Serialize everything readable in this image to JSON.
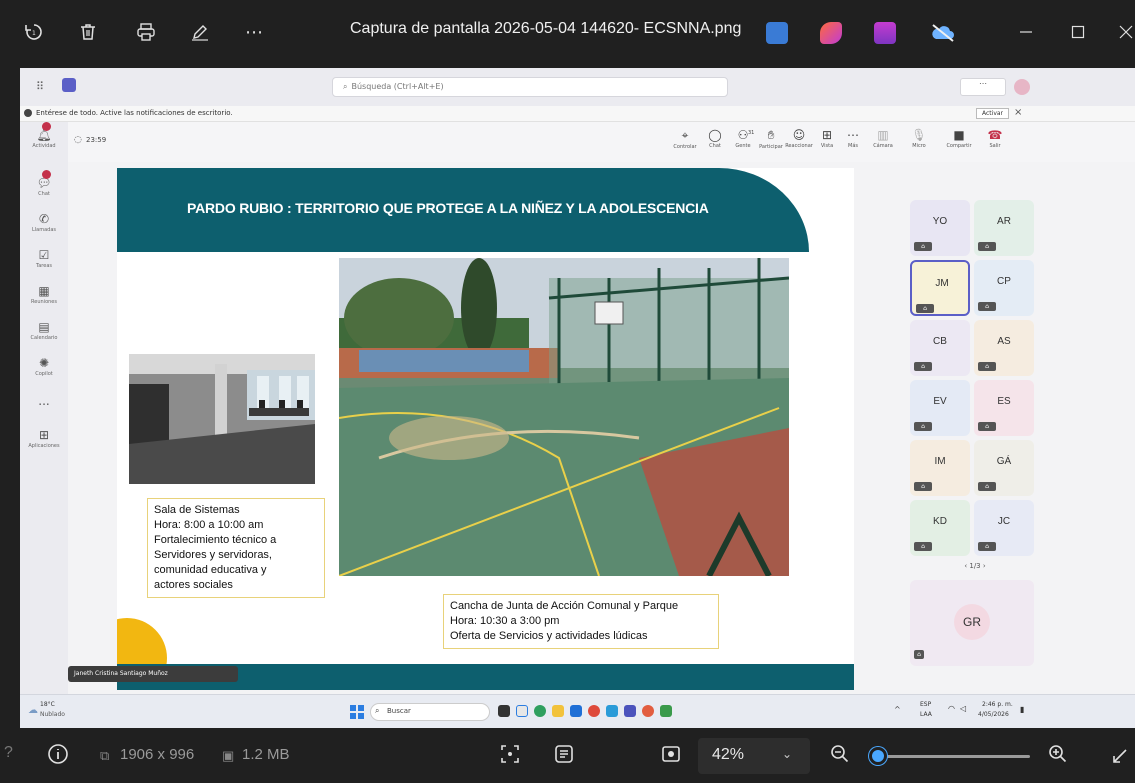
{
  "viewer": {
    "title": "Captura de pantalla 2026-05-04 144620- ECSNNA.png",
    "more_icon": "⋯",
    "dimensions": "1906 x 996",
    "file_size": "1.2 MB",
    "zoom_level": "42%",
    "zoom_fraction": 0.42
  },
  "teams": {
    "search_placeholder": "Búsqueda (Ctrl+Alt+E)",
    "notification": "Entérese de todo. Active las notificaciones de escritorio.",
    "notification_action": "Activar",
    "timer": "23:59",
    "rail": [
      {
        "label": "Actividad",
        "icon": "bell-icon"
      },
      {
        "label": "Chat",
        "icon": "chat-icon"
      },
      {
        "label": "Llamadas",
        "icon": "phone-icon"
      },
      {
        "label": "Tareas",
        "icon": "tasks-icon"
      },
      {
        "label": "Reuniones",
        "icon": "meetings-icon"
      },
      {
        "label": "Calendario",
        "icon": "calendar-icon"
      },
      {
        "label": "Copilot",
        "icon": "copilot-icon"
      },
      {
        "label": "...",
        "icon": "more-icon"
      },
      {
        "label": "Aplicaciones",
        "icon": "apps-icon"
      }
    ],
    "controls": [
      {
        "label": "Controlar"
      },
      {
        "label": "Chat"
      },
      {
        "label": "Gente"
      },
      {
        "label": "Participar"
      },
      {
        "label": "Reaccionar"
      },
      {
        "label": "Vista"
      },
      {
        "label": "Más"
      },
      {
        "label": "Cámara"
      },
      {
        "label": "Micro"
      },
      {
        "label": "Compartir"
      },
      {
        "label": "Salir"
      }
    ],
    "people_count": "31",
    "participants": [
      "YO",
      "AR",
      "JM",
      "CP",
      "CB",
      "AS",
      "EV",
      "ES",
      "IM",
      "GÁ",
      "KD",
      "JC"
    ],
    "pager": "1/3",
    "featured": "GR",
    "presenter_name": "Janeth Cristina Santiago Muñoz"
  },
  "slide": {
    "title": "PARDO RUBIO : TERRITORIO QUE PROTEGE A LA NIÑEZ Y LA ADOLESCENCIA",
    "caption_left": [
      "Sala de Sistemas",
      "Hora: 8:00 a 10:00 am",
      "Fortalecimiento técnico a",
      "Servidores y servidoras,",
      "comunidad educativa y",
      "actores sociales"
    ],
    "caption_right": [
      "Cancha de Junta de Acción Comunal  y Parque",
      "Hora: 10:30 a 3:00 pm",
      "Oferta de Servicios y actividades lúdicas"
    ]
  },
  "taskbar": {
    "weather_temp": "18°C",
    "weather_desc": "Nublado",
    "search": "Buscar",
    "lang1": "ESP",
    "lang2": "LAA",
    "time": "2:46 p. m.",
    "date": "4/05/2026"
  },
  "colors": {
    "slide_teal": "#0d5f6e",
    "slide_yellow": "#f2b711",
    "zoom_accent": "#4aa8ff"
  }
}
